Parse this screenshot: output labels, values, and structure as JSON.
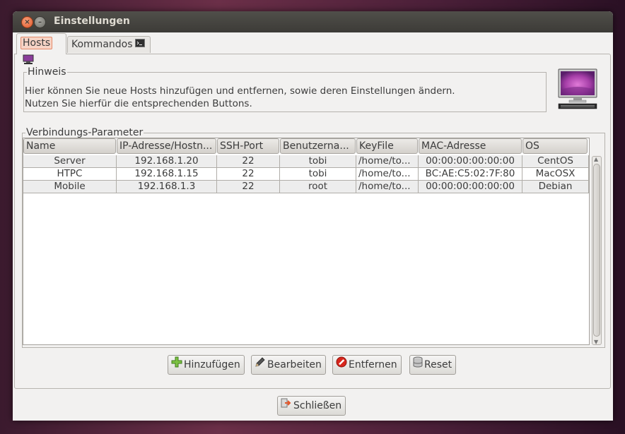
{
  "window": {
    "title": "Einstellungen"
  },
  "tabs": [
    {
      "label": "Hosts",
      "icon": "monitor-icon",
      "active": true
    },
    {
      "label": "Kommandos",
      "icon": "terminal-icon",
      "active": false
    }
  ],
  "hint": {
    "legend": "Hinweis",
    "line1": "Hier können Sie neue Hosts hinzufügen und entfernen, sowie deren Einstellungen ändern.",
    "line2": "Nutzen Sie hierfür die entsprechenden Buttons."
  },
  "connection": {
    "legend": "Verbindungs-Parameter",
    "columns": [
      "Name",
      "IP-Adresse/Hostn...",
      "SSH-Port",
      "Benutzerna...",
      "KeyFile",
      "MAC-Adresse",
      "OS"
    ],
    "rows": [
      [
        "Server",
        "192.168.1.20",
        "22",
        "tobi",
        "/home/to...",
        "00:00:00:00:00:00",
        "CentOS"
      ],
      [
        "HTPC",
        "192.168.1.15",
        "22",
        "tobi",
        "/home/to...",
        "BC:AE:C5:02:7F:80",
        "MacOSX"
      ],
      [
        "Mobile",
        "192.168.1.3",
        "22",
        "root",
        "/home/to...",
        "00:00:00:00:00:00",
        "Debian"
      ]
    ]
  },
  "buttons": {
    "add": "Hinzufügen",
    "edit": "Bearbeiten",
    "remove": "Entfernen",
    "reset": "Reset",
    "close": "Schließen"
  },
  "colors": {
    "accent": "#e2562a",
    "titlebar": "#3c3b37",
    "monitor_screen": "#a63fa8"
  }
}
